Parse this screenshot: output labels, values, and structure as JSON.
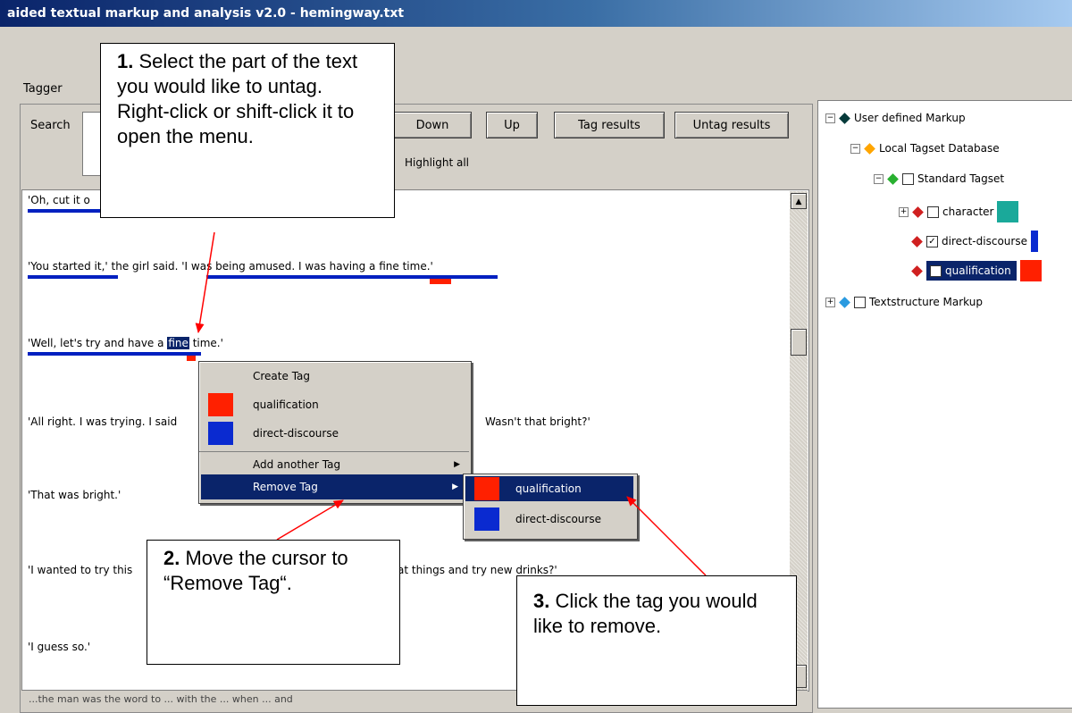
{
  "window": {
    "title": "aided textual markup and analysis v2.0  - hemingway.txt"
  },
  "tab": {
    "label": "Tagger"
  },
  "search": {
    "label": "Search",
    "highlight_all": "Highlight all"
  },
  "buttons": {
    "down": "Down",
    "up": "Up",
    "tag_results": "Tag results",
    "untag_results": "Untag results"
  },
  "text_lines": [
    "'Oh, cut it o",
    "'You started it,' the girl said. 'I was being amused. I was having a fine time.'",
    "'Well, let's try and have a",
    "fine",
    "time.'",
    "'All right. I was trying. I said",
    "Wasn't that bright?'",
    "'That was bright.'",
    "'I wanted to try this",
    "at things and try new drinks?'",
    "'I guess so.'"
  ],
  "status": {
    "text": "...the man was the word to ... with the ... when ... and"
  },
  "context_menu": {
    "create_tag": "Create Tag",
    "items": [
      {
        "label": "qualification",
        "color": "#ff2000"
      },
      {
        "label": "direct-discourse",
        "color": "#0a2ad0"
      }
    ],
    "add_another": "Add another Tag",
    "remove": "Remove Tag",
    "arrow": "▶"
  },
  "submenu": {
    "items": [
      {
        "label": "qualification",
        "color": "#ff2000"
      },
      {
        "label": "direct-discourse",
        "color": "#0a2ad0"
      }
    ]
  },
  "tree": {
    "root": "User defined Markup",
    "database": "Local Tagset Database",
    "tagset": "Standard Tagset",
    "tags": [
      {
        "label": "character",
        "checked": false,
        "color": "#1aa99a"
      },
      {
        "label": "direct-discourse",
        "checked": true,
        "color": "#0a2ad0"
      },
      {
        "label": "qualification",
        "checked": true,
        "color": "#ff2000"
      }
    ],
    "textstructure": "Textstructure Markup",
    "plus": "+",
    "minus": "−",
    "check": "✓"
  },
  "callouts": {
    "c1_num": "1.",
    "c1_text": "Select the part of the text you would like to untag. Right-click or shift-click it to open the menu.",
    "c2_num": "2.",
    "c2_text": "Move the cursor to “Remove Tag“.",
    "c3_num": "3.",
    "c3_text": "Click the tag you would like to remove."
  }
}
